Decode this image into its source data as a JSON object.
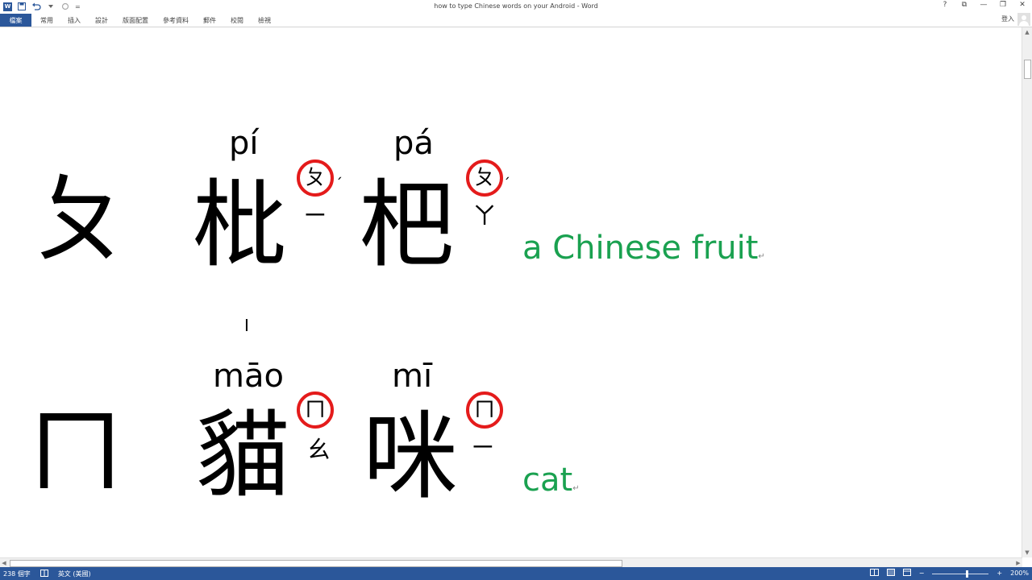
{
  "window": {
    "title": "how to type Chinese words on your Android - Word",
    "controls": [
      "?",
      "⧉",
      "—",
      "❐",
      "✕"
    ]
  },
  "qat": {
    "app_icon": "W",
    "save_icon": "save-icon",
    "undo_icon": "undo-icon",
    "redo_icon": "redo-icon",
    "customize": "="
  },
  "ribbon": {
    "file_tab": "檔案",
    "tabs": [
      "常用",
      "插入",
      "設計",
      "版面配置",
      "參考資料",
      "郵件",
      "校閱",
      "檢視"
    ],
    "sign_in": "登入"
  },
  "document": {
    "row1": {
      "initial": "ㄆ",
      "char1": {
        "hanzi": "枇",
        "pinyin": "pí",
        "circled": "ㄆ",
        "tone": "ˊ",
        "final": "ㄧ"
      },
      "char2": {
        "hanzi": "杷",
        "pinyin": "pá",
        "circled": "ㄆ",
        "tone": "ˊ",
        "final": "ㄚ"
      },
      "meaning": "a Chinese fruit"
    },
    "row2": {
      "initial": "ㄇ",
      "char1": {
        "hanzi": "貓",
        "pinyin": "māo",
        "circled": "ㄇ",
        "final": "ㄠ"
      },
      "char2": {
        "hanzi": "咪",
        "pinyin": "mī",
        "circled": "ㄇ",
        "final": "ㄧ"
      },
      "meaning": "cat"
    },
    "paragraph_mark": "↵",
    "cursor": "I"
  },
  "status": {
    "word_count": "238 個字",
    "language": "英文 (美國)",
    "zoom": "200%",
    "zoom_minus": "−",
    "zoom_plus": "+",
    "zoom_level": 0.62
  },
  "colors": {
    "accent": "#2b579a",
    "meaning_green": "#1aa150",
    "circle_red": "#e41b1b"
  }
}
